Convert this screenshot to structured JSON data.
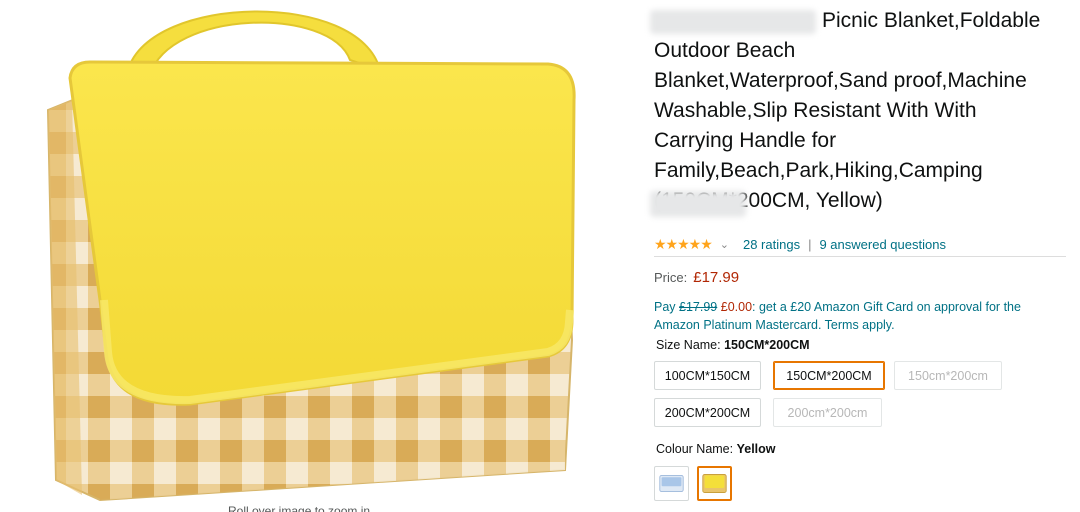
{
  "product": {
    "title": "Picnic Blanket,Foldable Outdoor Beach Blanket,Waterproof,Sand proof,Machine Washable,Slip Resistant With With Carrying Handle for Family,Beach,Park,Hiking,Camping (150CM*200CM, Yellow)",
    "title_lines": [
      "Picnic Blanket,Foldable",
      "Outdoor Beach",
      "Blanket,Waterproof,Sand proof,Machine",
      "Washable,Slip Resistant With With",
      "Carrying Handle for",
      "Family,Beach,Park,Hiking,Camping",
      "(150CM*200CM, Yellow)"
    ],
    "rating_stars": 5,
    "ratings_text": "28 ratings",
    "answered_text": "9 answered questions",
    "zoom_hint": "Roll over image to zoom in"
  },
  "price": {
    "label": "Price:",
    "value": "£17.99"
  },
  "promo": {
    "pay": "Pay",
    "old_price": "£17.99",
    "new_price": "£0.00",
    "text": ": get a £20 Amazon Gift Card on approval for the Amazon Platinum Mastercard. Terms apply."
  },
  "size": {
    "label": "Size Name:",
    "selected": "150CM*200CM",
    "options": [
      {
        "label": "100CM*150CM",
        "state": "available"
      },
      {
        "label": "150CM*200CM",
        "state": "selected"
      },
      {
        "label": "150cm*200cm",
        "state": "unavailable"
      },
      {
        "label": "200CM*200CM",
        "state": "available"
      },
      {
        "label": "200cm*200cm",
        "state": "unavailable"
      }
    ]
  },
  "colour": {
    "label": "Colour Name:",
    "selected": "Yellow",
    "swatches": [
      {
        "name": "blue",
        "icon": "blue-blanket-swatch",
        "color": "#a9c6e8"
      },
      {
        "name": "yellow",
        "icon": "yellow-blanket-swatch",
        "color": "#f4df3a"
      }
    ]
  },
  "colors": {
    "accent": "#e77600",
    "link": "#007185",
    "price": "#b12704",
    "star": "#ffa41c",
    "blanket_yellow": "#f7e13f",
    "check_tan": "#d9a948"
  }
}
